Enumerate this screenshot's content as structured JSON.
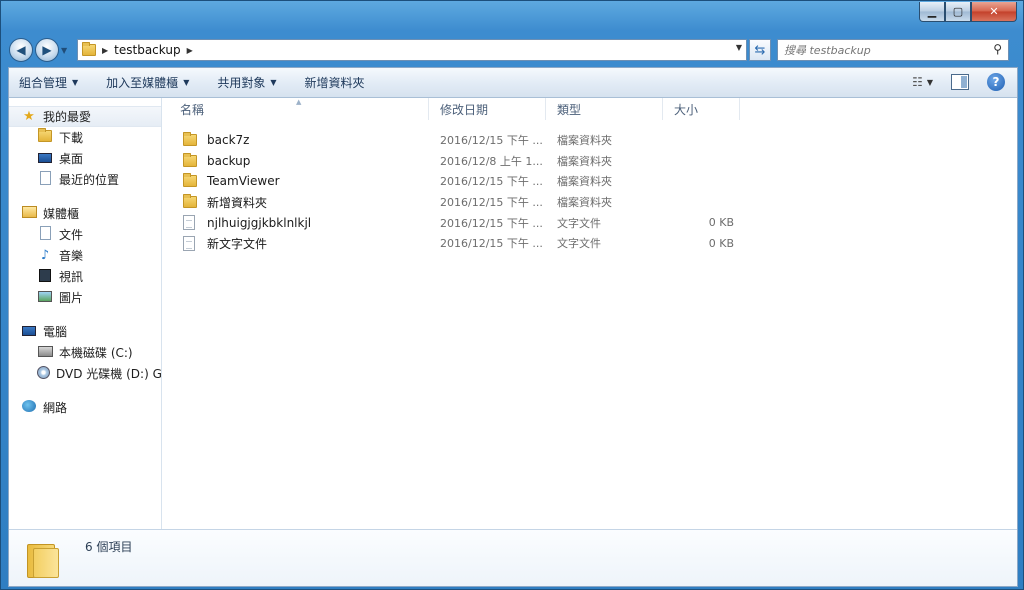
{
  "window": {
    "caption_buttons": [
      "minimize-icon",
      "maximize-icon",
      "close-icon"
    ]
  },
  "navbar": {
    "path": [
      "testbackup"
    ],
    "search_placeholder": "搜尋 testbackup"
  },
  "toolbar": {
    "organize": "組合管理",
    "include_library": "加入至媒體櫃",
    "share_with": "共用對象",
    "new_folder": "新增資料夾"
  },
  "sidebar": {
    "favorites": {
      "label": "我的最愛",
      "items": [
        {
          "label": "下載",
          "icon": "downloads-icon"
        },
        {
          "label": "桌面",
          "icon": "desktop-icon"
        },
        {
          "label": "最近的位置",
          "icon": "recent-places-icon"
        }
      ]
    },
    "libraries": {
      "label": "媒體櫃",
      "items": [
        {
          "label": "文件",
          "icon": "documents-icon"
        },
        {
          "label": "音樂",
          "icon": "music-icon"
        },
        {
          "label": "視訊",
          "icon": "videos-icon"
        },
        {
          "label": "圖片",
          "icon": "pictures-icon"
        }
      ]
    },
    "computer": {
      "label": "電腦",
      "items": [
        {
          "label": "本機磁碟 (C:)",
          "icon": "hard-drive-icon"
        },
        {
          "label": "DVD 光碟機 (D:) GR",
          "icon": "dvd-drive-icon"
        }
      ]
    },
    "network": {
      "label": "網路"
    }
  },
  "columns": {
    "name": "名稱",
    "date": "修改日期",
    "type": "類型",
    "size": "大小"
  },
  "files": [
    {
      "name": "back7z",
      "date": "2016/12/15 下午 ...",
      "type": "檔案資料夾",
      "size": "",
      "icon": "folder-icon"
    },
    {
      "name": "backup",
      "date": "2016/12/8 上午 1...",
      "type": "檔案資料夾",
      "size": "",
      "icon": "folder-icon"
    },
    {
      "name": "TeamViewer",
      "date": "2016/12/15 下午 ...",
      "type": "檔案資料夾",
      "size": "",
      "icon": "folder-icon"
    },
    {
      "name": "新增資料夾",
      "date": "2016/12/15 下午 ...",
      "type": "檔案資料夾",
      "size": "",
      "icon": "folder-icon"
    },
    {
      "name": "njlhuigjgjkbklnlkjl",
      "date": "2016/12/15 下午 ...",
      "type": "文字文件",
      "size": "0 KB",
      "icon": "text-file-icon"
    },
    {
      "name": "新文字文件",
      "date": "2016/12/15 下午 ...",
      "type": "文字文件",
      "size": "0 KB",
      "icon": "text-file-icon"
    }
  ],
  "status": {
    "item_count": "6 個項目"
  }
}
